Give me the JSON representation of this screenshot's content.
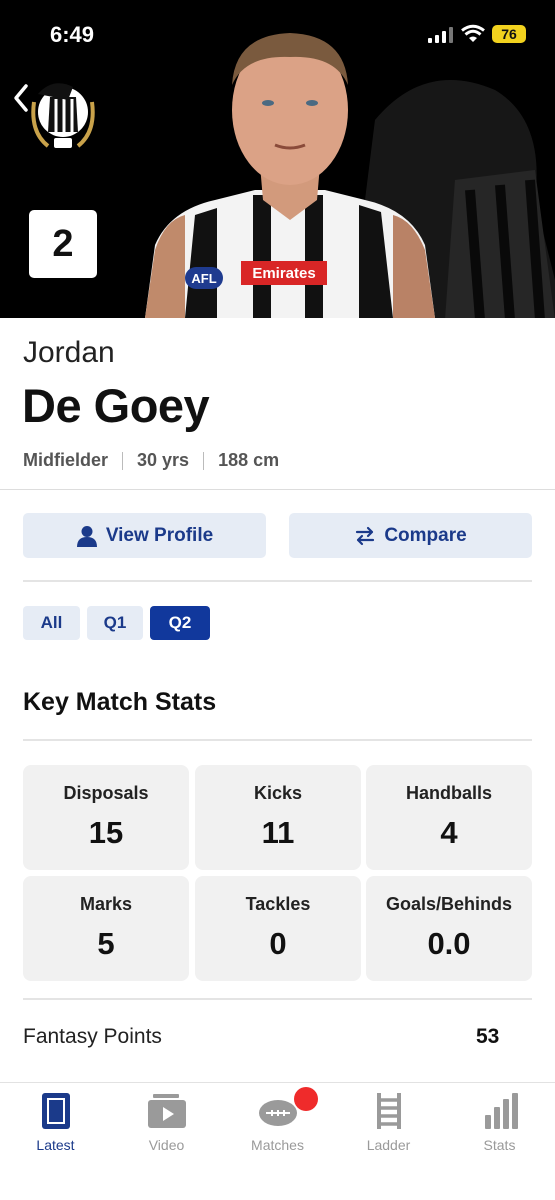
{
  "status_bar": {
    "time": "6:49",
    "battery": "76"
  },
  "player": {
    "jersey_number": "2",
    "first_name": "Jordan",
    "last_name": "De Goey",
    "position": "Midfielder",
    "age": "30 yrs",
    "height": "188 cm"
  },
  "actions": {
    "view_profile": "View Profile",
    "compare": "Compare"
  },
  "quarter_tabs": [
    {
      "label": "All",
      "active": false
    },
    {
      "label": "Q1",
      "active": false
    },
    {
      "label": "Q2",
      "active": true
    }
  ],
  "key_stats": {
    "title": "Key Match Stats",
    "items": [
      {
        "label": "Disposals",
        "value": "15"
      },
      {
        "label": "Kicks",
        "value": "11"
      },
      {
        "label": "Handballs",
        "value": "4"
      },
      {
        "label": "Marks",
        "value": "5"
      },
      {
        "label": "Tackles",
        "value": "0"
      },
      {
        "label": "Goals/Behinds",
        "value": "0.0"
      }
    ]
  },
  "fantasy": {
    "label": "Fantasy Points",
    "value": "53"
  },
  "bottom_nav": [
    {
      "label": "Latest",
      "icon": "latest-icon",
      "active": true
    },
    {
      "label": "Video",
      "icon": "video-icon",
      "active": false
    },
    {
      "label": "Matches",
      "icon": "football-icon",
      "active": false
    },
    {
      "label": "Ladder",
      "icon": "ladder-icon",
      "active": false
    },
    {
      "label": "Stats",
      "icon": "stats-icon",
      "active": false
    }
  ],
  "colors": {
    "accent": "#11389c",
    "button_bg": "#e6ecf5",
    "button_text": "#1b3a8a",
    "notification": "#ef2b2b",
    "battery": "#f2d21e"
  },
  "sponsor_logos": [
    "AFL",
    "Emirates"
  ]
}
